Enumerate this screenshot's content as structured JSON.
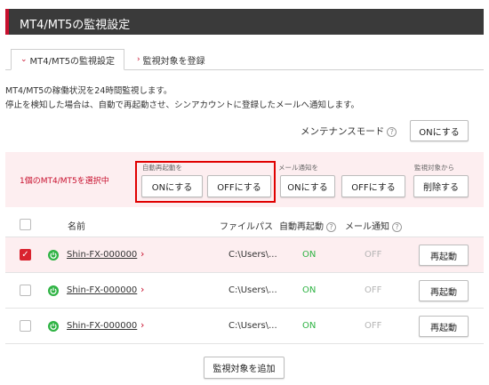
{
  "page_title": "MT4/MT5の監視設定",
  "tabs": [
    {
      "label": "MT4/MT5の監視設定",
      "active": true
    },
    {
      "label": "監視対象を登録",
      "active": false
    }
  ],
  "description": [
    "MT4/MT5の稼働状況を24時間監視します。",
    "停止を検知した場合は、自動で再起動させ、シンアカウントに登録したメールへ通知します。"
  ],
  "maintenance": {
    "label": "メンテナンスモード",
    "help": "?",
    "button": "ONにする"
  },
  "actions": {
    "selected_text": "1個のMT4/MT5を選択中",
    "auto_restart": {
      "label": "自動再起動を",
      "on": "ONにする",
      "off": "OFFにする"
    },
    "mail_notify": {
      "label": "メール通知を",
      "on": "ONにする",
      "off": "OFFにする"
    },
    "remove": {
      "label": "監視対象から",
      "button": "削除する"
    }
  },
  "table": {
    "headers": {
      "name": "名前",
      "path": "ファイルパス",
      "auto_restart": "自動再起動",
      "mail": "メール通知",
      "help": "?"
    },
    "rows": [
      {
        "checked": true,
        "name": "Shin-FX-000000",
        "path": "C:\\Users\\...",
        "auto_restart": "ON",
        "mail": "OFF",
        "action": "再起動"
      },
      {
        "checked": false,
        "name": "Shin-FX-000000",
        "path": "C:\\Users\\...",
        "auto_restart": "ON",
        "mail": "OFF",
        "action": "再起動"
      },
      {
        "checked": false,
        "name": "Shin-FX-000000",
        "path": "C:\\Users\\...",
        "auto_restart": "ON",
        "mail": "OFF",
        "action": "再起動"
      }
    ]
  },
  "add_button": "監視対象を追加",
  "colors": {
    "accent": "#c8102e",
    "header_bg": "#3a3a3a",
    "band_bg": "#fdeef0",
    "status_on": "#2fb344",
    "status_off": "#b5b5b5",
    "highlight": "#e00000"
  },
  "icons": {
    "tab_chevron": "chevron-down-icon",
    "link_chevron": "chevron-right-icon",
    "status": "power-icon",
    "checkbox": "check-icon"
  }
}
